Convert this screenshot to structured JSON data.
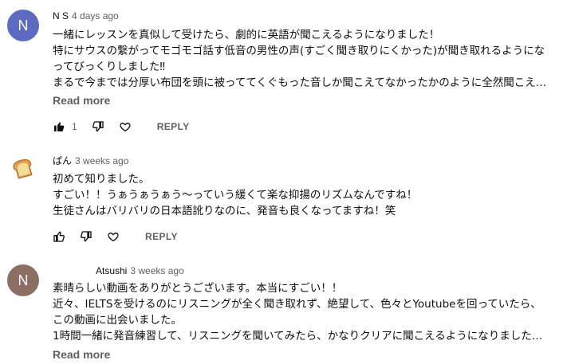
{
  "comments": [
    {
      "avatar_letter": "N",
      "avatar_color": "#5c6bc0",
      "author": "N S",
      "time": "4 days ago",
      "lines": [
        "一緒にレッスンを真似して受けたら、劇的に英語が聞こえるようになりました！",
        "特にサウスの繋がってモゴモゴ話す低音の男性の声(すごく聞き取りにくかった)が聞き取れるようにな",
        "ってびっくりしました‼",
        "まるで今までは分厚い布団を頭に被っててくぐもった音しか聞こえてなかったかのように全然聞こえ…"
      ],
      "read_more": "Read more",
      "likes": "1",
      "reply": "REPLY",
      "liked": true
    },
    {
      "avatar_icon": "bread-toast-icon",
      "author": "ぱん",
      "time": "3 weeks ago",
      "lines": [
        "初めて知りました。",
        "すごい！！うぁうぁうぁう〜っていう緩くて楽な抑揚のリズムなんですね！",
        "生徒さんはバリバリの日本語訛りなのに、発音も良くなってますね！笑"
      ],
      "reply": "REPLY",
      "liked": false
    },
    {
      "avatar_letter": "N",
      "avatar_color": "#8d6e63",
      "author": "Atsushi",
      "time": "3 weeks ago",
      "lines": [
        "素晴らしい動画をありがとうございます。本当にすごい！！",
        "近々、IELTSを受けるのにリスニングが全く聞き取れず、絶望して、色々とYoutubeを回っていたら、",
        "この動画に出会いました。",
        "1時間一緒に発音練習して、リスニングを聞いてみたら、かなりクリアに聞こえるようになりました…"
      ],
      "read_more": "Read more"
    }
  ]
}
